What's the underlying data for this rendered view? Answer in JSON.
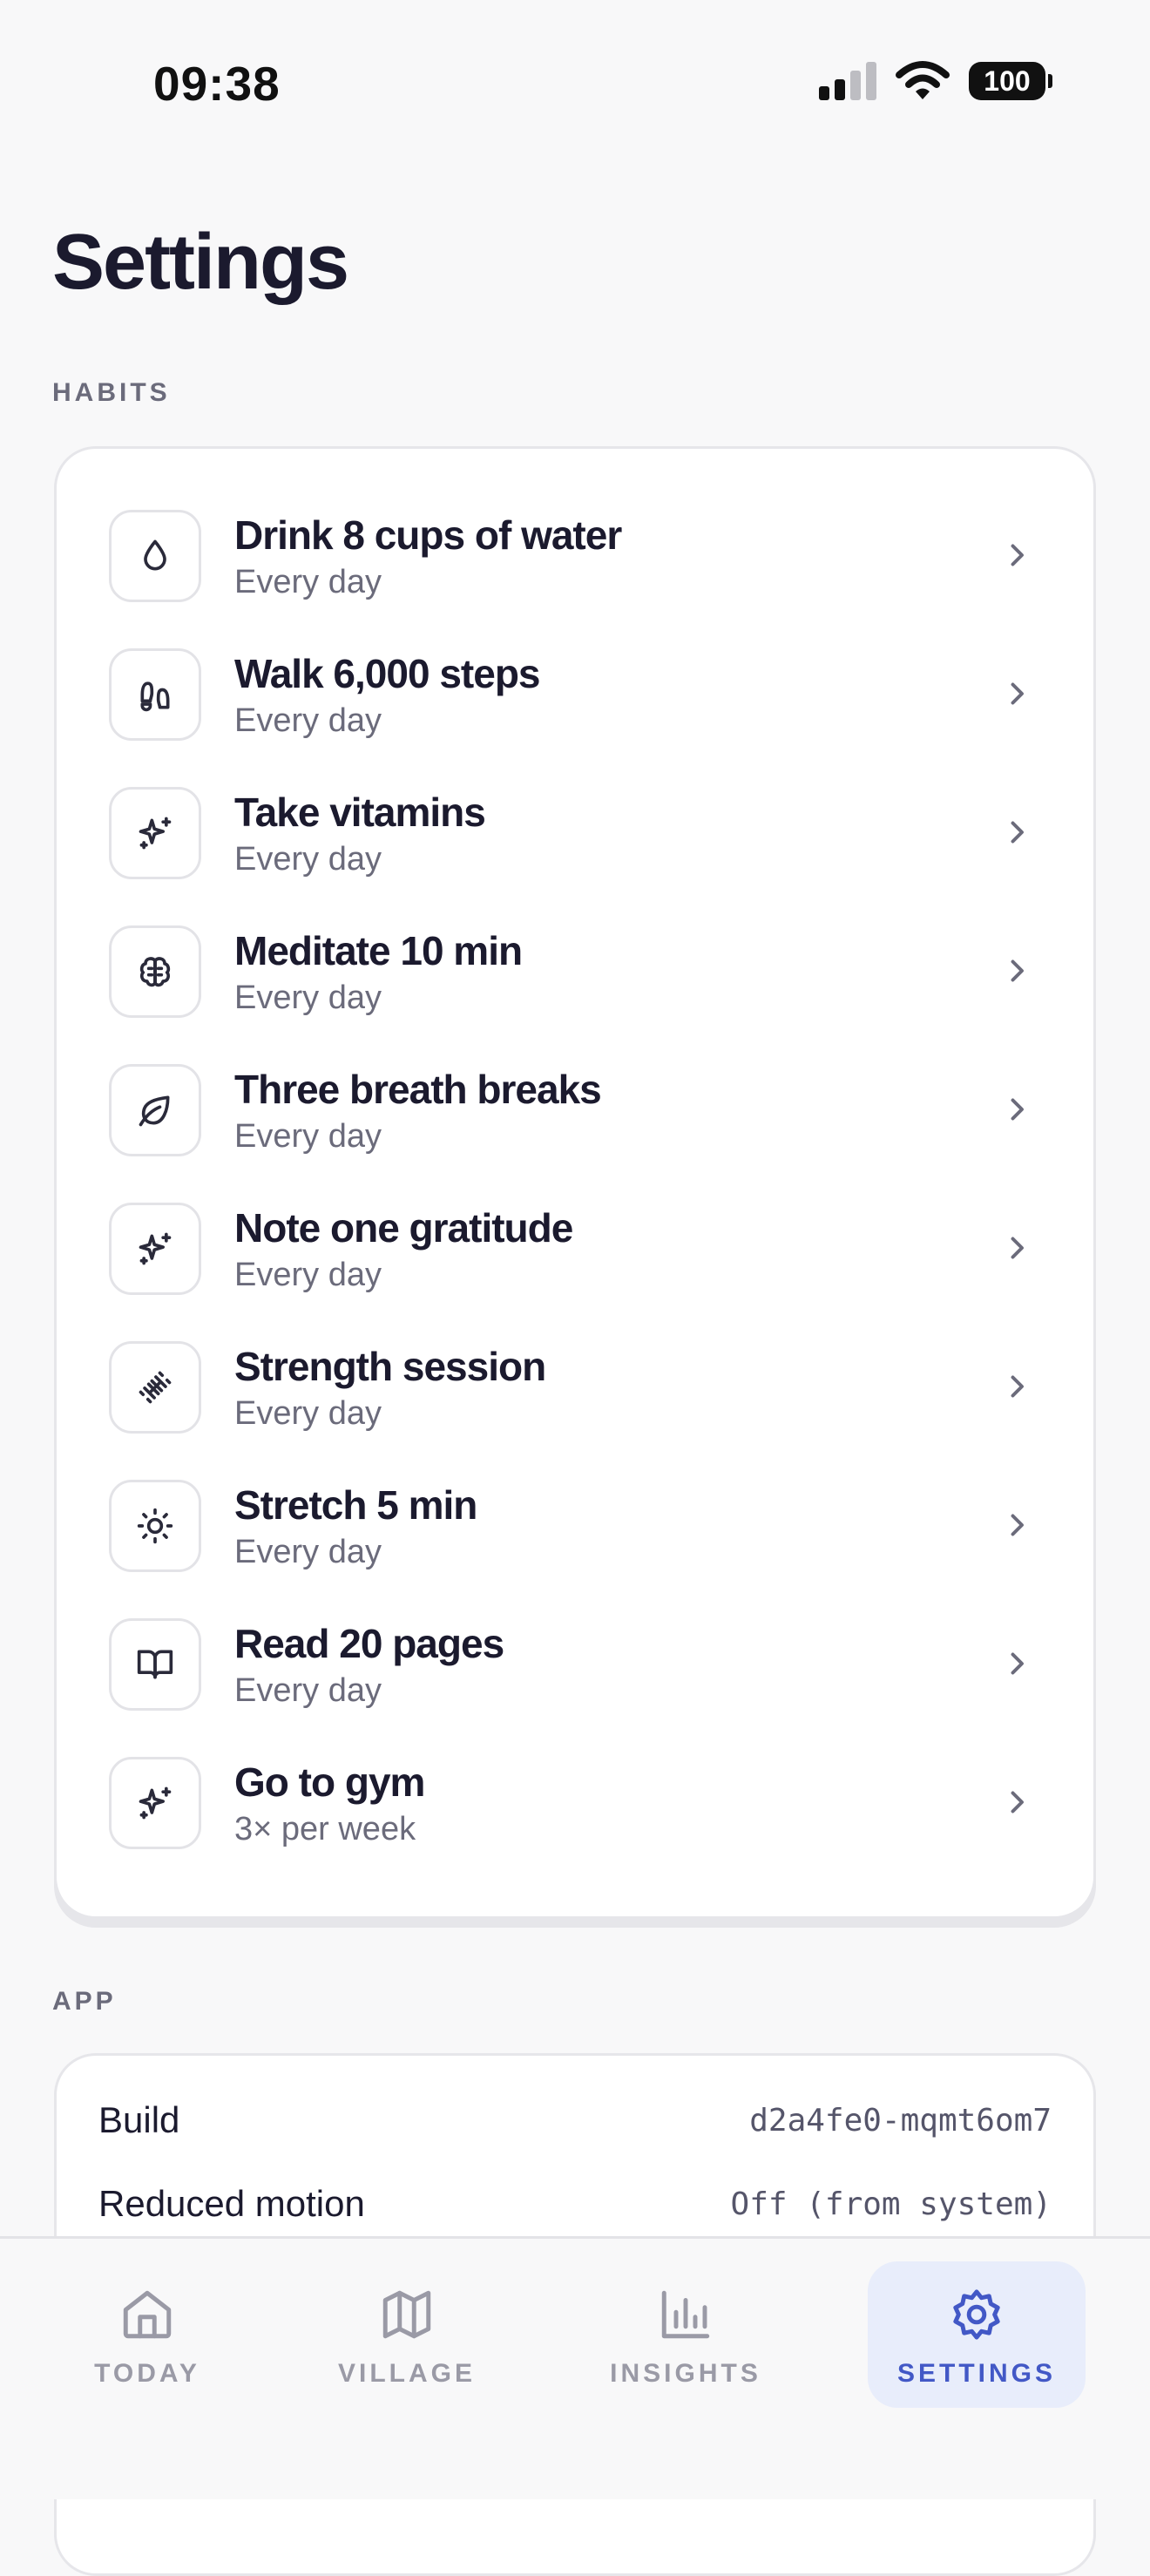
{
  "status_bar": {
    "time": "09:38",
    "battery": "100"
  },
  "page": {
    "title": "Settings"
  },
  "sections": {
    "habits": "HABITS",
    "app": "APP"
  },
  "habits": [
    {
      "title": "Drink 8 cups of water",
      "frequency": "Every day",
      "icon": "droplet-icon"
    },
    {
      "title": "Walk 6,000 steps",
      "frequency": "Every day",
      "icon": "footprints-icon"
    },
    {
      "title": "Take vitamins",
      "frequency": "Every day",
      "icon": "sparkles-icon"
    },
    {
      "title": "Meditate 10 min",
      "frequency": "Every day",
      "icon": "brain-icon"
    },
    {
      "title": "Three breath breaks",
      "frequency": "Every day",
      "icon": "leaf-icon"
    },
    {
      "title": "Note one gratitude",
      "frequency": "Every day",
      "icon": "sparkles-icon"
    },
    {
      "title": "Strength session",
      "frequency": "Every day",
      "icon": "dumbbell-icon"
    },
    {
      "title": "Stretch 5 min",
      "frequency": "Every day",
      "icon": "sun-icon"
    },
    {
      "title": "Read 20 pages",
      "frequency": "Every day",
      "icon": "book-icon"
    },
    {
      "title": "Go to gym",
      "frequency": "3× per week",
      "icon": "sparkles-icon"
    }
  ],
  "app": {
    "build_label": "Build",
    "build_value": "d2a4fe0-mqmt6om7",
    "motion_label": "Reduced motion",
    "motion_value": "Off (from system)"
  },
  "tabs": [
    {
      "label": "TODAY",
      "icon": "home-icon",
      "active": false
    },
    {
      "label": "VILLAGE",
      "icon": "map-icon",
      "active": false
    },
    {
      "label": "INSIGHTS",
      "icon": "bar-chart-icon",
      "active": false
    },
    {
      "label": "SETTINGS",
      "icon": "gear-icon",
      "active": true
    }
  ],
  "colors": {
    "accent": "#4258c6",
    "accent_bg": "#e8edfb",
    "text": "#1b1a2e",
    "muted": "#6b6b7b"
  }
}
